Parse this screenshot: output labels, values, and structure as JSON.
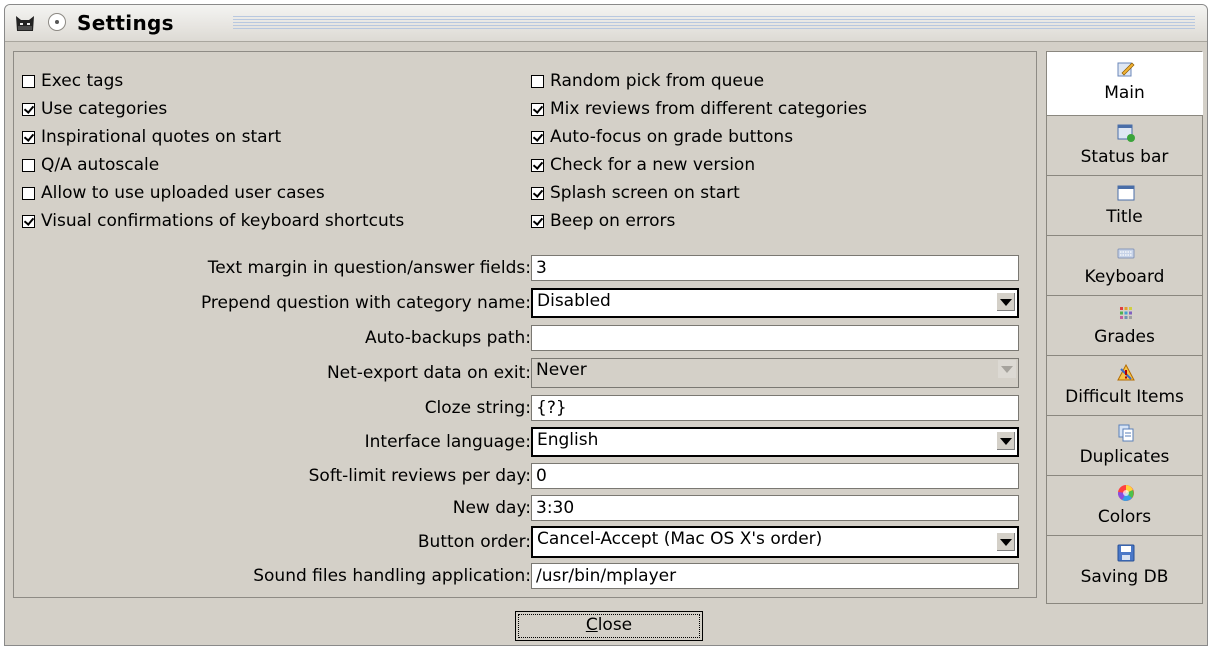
{
  "window": {
    "title": "Settings"
  },
  "checkboxes_left": [
    {
      "label": "Exec tags",
      "checked": false
    },
    {
      "label": "Use categories",
      "checked": true
    },
    {
      "label": "Inspirational quotes on start",
      "checked": true
    },
    {
      "label": "Q/A autoscale",
      "checked": false
    },
    {
      "label": "Allow to use uploaded user cases",
      "checked": false
    },
    {
      "label": "Visual confirmations of keyboard shortcuts",
      "checked": true
    }
  ],
  "checkboxes_right": [
    {
      "label": "Random pick from queue",
      "checked": false
    },
    {
      "label": "Mix reviews from different categories",
      "checked": true
    },
    {
      "label": "Auto-focus on grade buttons",
      "checked": true
    },
    {
      "label": "Check for a new version",
      "checked": true
    },
    {
      "label": "Splash screen on start",
      "checked": true
    },
    {
      "label": "Beep on errors",
      "checked": true
    }
  ],
  "form": {
    "text_margin": {
      "label": "Text margin in question/answer fields:",
      "value": "3"
    },
    "prepend_category": {
      "label": "Prepend question with category name:",
      "value": "Disabled"
    },
    "backups_path": {
      "label": "Auto-backups path:",
      "value": ""
    },
    "net_export": {
      "label": "Net-export data on exit:",
      "value": "Never"
    },
    "cloze_string": {
      "label": "Cloze string:",
      "value": "{?}"
    },
    "interface_language": {
      "label": "Interface language:",
      "value": "English"
    },
    "soft_limit": {
      "label": "Soft-limit reviews per day:",
      "value": "0"
    },
    "new_day": {
      "label": "New day:",
      "value": "3:30"
    },
    "button_order": {
      "label": "Button order:",
      "value": "Cancel-Accept (Mac OS X's order)"
    },
    "sound_app": {
      "label": "Sound files handling application:",
      "value": "/usr/bin/mplayer"
    }
  },
  "tabs": [
    {
      "label": "Main",
      "icon": "pencil-note-icon",
      "active": true
    },
    {
      "label": "Status bar",
      "icon": "status-bar-icon",
      "active": false
    },
    {
      "label": "Title",
      "icon": "window-title-icon",
      "active": false
    },
    {
      "label": "Keyboard",
      "icon": "keyboard-icon",
      "active": false
    },
    {
      "label": "Grades",
      "icon": "grades-grid-icon",
      "active": false
    },
    {
      "label": "Difficult Items",
      "icon": "warning-icon",
      "active": false
    },
    {
      "label": "Duplicates",
      "icon": "duplicate-pages-icon",
      "active": false
    },
    {
      "label": "Colors",
      "icon": "color-wheel-icon",
      "active": false
    },
    {
      "label": "Saving DB",
      "icon": "floppy-disk-icon",
      "active": false
    }
  ],
  "footer": {
    "close_label_mnemonic": "C",
    "close_label_rest": "lose"
  },
  "colors": {
    "window_bg": "#d4d0c8",
    "active_tab_bg": "#ffffff"
  }
}
